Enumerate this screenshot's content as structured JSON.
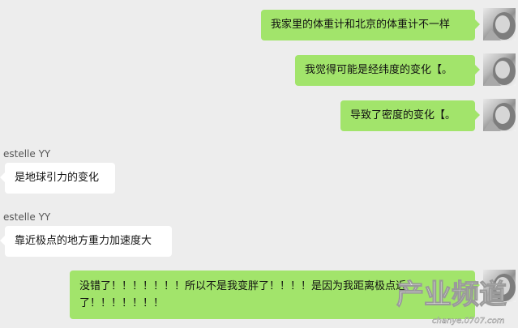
{
  "messages": [
    {
      "side": "right",
      "text": "我家里的体重计和北京的体重计不一样"
    },
    {
      "side": "right",
      "text": "我觉得可能是经纬度的变化【。"
    },
    {
      "side": "right",
      "text": "导致了密度的变化【。"
    },
    {
      "side": "left",
      "sender": "estelle YY",
      "text": "是地球引力的变化"
    },
    {
      "side": "left",
      "sender": "estelle YY",
      "text": "靠近极点的地方重力加速度大"
    },
    {
      "side": "right",
      "text": "没错了！！！！！！！所以不是我变胖了！！！！是因为我距离极点近了！！！！！！！"
    }
  ],
  "watermark": {
    "main": "产业频道",
    "url": "chanye.0707.com"
  },
  "colors": {
    "background": "#ededed",
    "self_bubble": "#a2e46b",
    "other_bubble": "#ffffff"
  }
}
